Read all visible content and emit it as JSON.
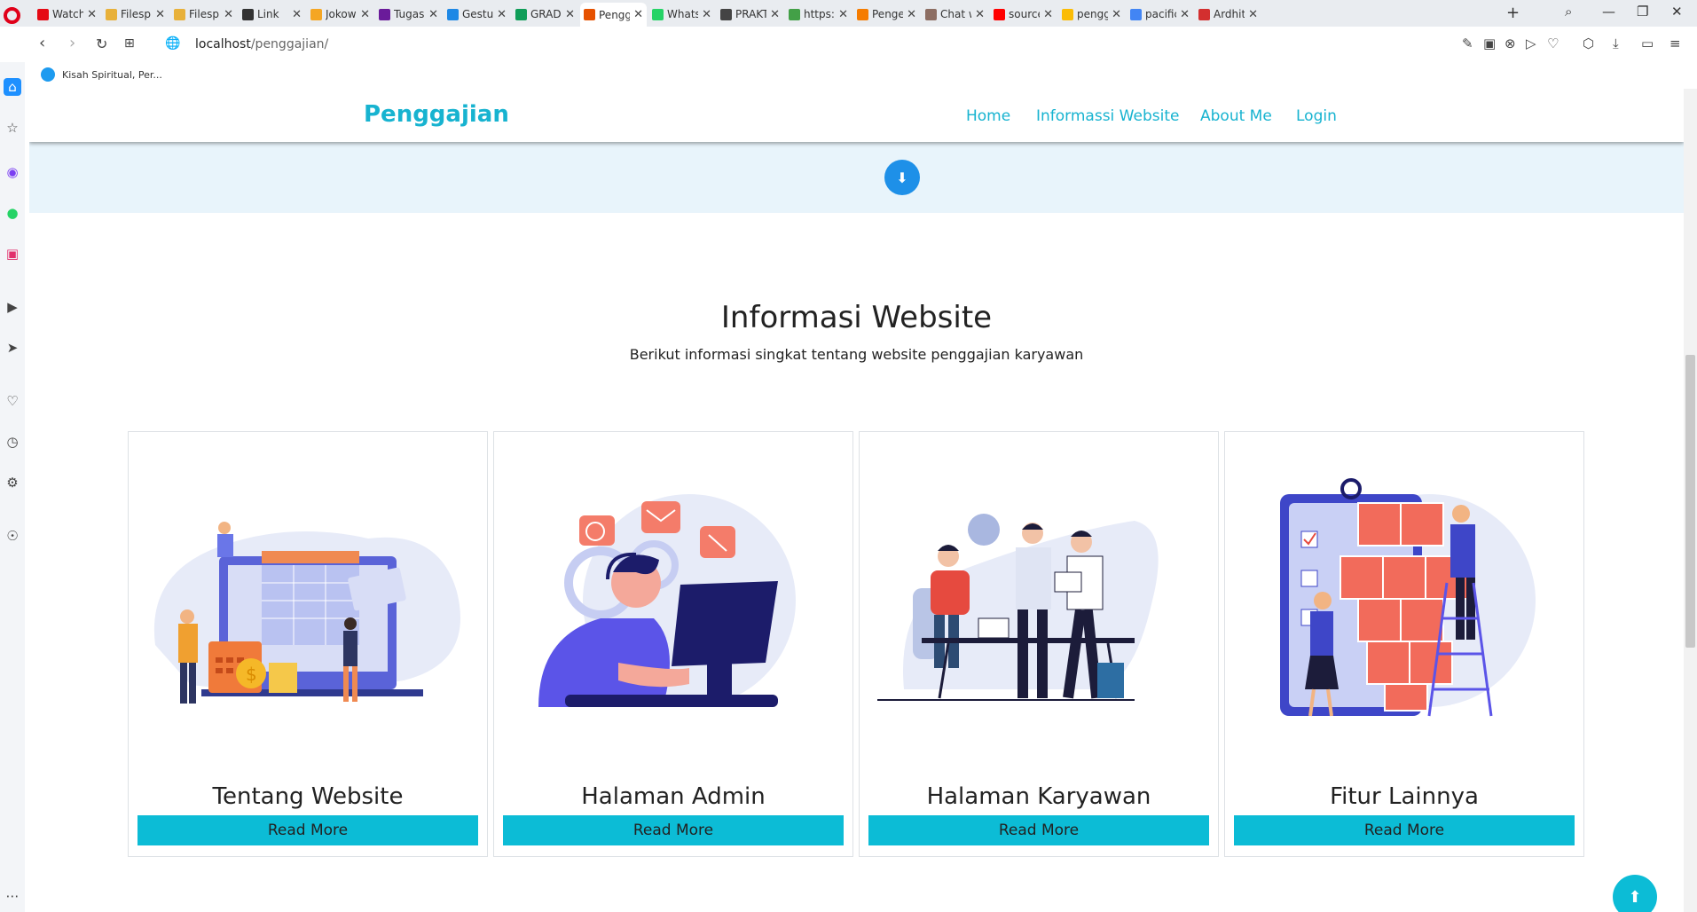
{
  "browser": {
    "tabs": [
      {
        "label": "Watch",
        "color": "#e50914"
      },
      {
        "label": "Filespr",
        "color": "#e8b13a"
      },
      {
        "label": "Filespr",
        "color": "#e8b13a"
      },
      {
        "label": "Link",
        "color": "#333333"
      },
      {
        "label": "Jokowi",
        "color": "#f5a623"
      },
      {
        "label": "Tugas",
        "color": "#6a1b9a"
      },
      {
        "label": "Gestur",
        "color": "#1e88e5"
      },
      {
        "label": "GRADE",
        "color": "#0f9d58"
      },
      {
        "label": "Penggi",
        "color": "#e65100",
        "active": true
      },
      {
        "label": "Whats",
        "color": "#25d366"
      },
      {
        "label": "PRAKT",
        "color": "#444444"
      },
      {
        "label": "https:/",
        "color": "#43a047"
      },
      {
        "label": "Penger",
        "color": "#f57c00"
      },
      {
        "label": "Chat w",
        "color": "#8d6e63"
      },
      {
        "label": "source",
        "color": "#ff0000"
      },
      {
        "label": "penggi",
        "color": "#fbbc05"
      },
      {
        "label": "pacific",
        "color": "#4285f4"
      },
      {
        "label": "Ardhit",
        "color": "#d32f2f"
      }
    ],
    "url_host": "localhost",
    "url_path": "/penggajian/",
    "bookmark": "Kisah Spiritual, Per..."
  },
  "site": {
    "brand": "Penggajian",
    "nav": [
      "Home",
      "Informassi Website",
      "About Me",
      "Login"
    ],
    "section_title": "Informasi Website",
    "section_subtitle": "Berikut informasi singkat tentang website penggajian karyawan",
    "cards": [
      {
        "title": "Tentang Website",
        "button": "Read More"
      },
      {
        "title": "Halaman Admin",
        "button": "Read More"
      },
      {
        "title": "Halaman Karyawan",
        "button": "Read More"
      },
      {
        "title": "Fitur Lainnya",
        "button": "Read More"
      }
    ],
    "accent": "#17b3d0",
    "button_color": "#0cbcd6"
  }
}
